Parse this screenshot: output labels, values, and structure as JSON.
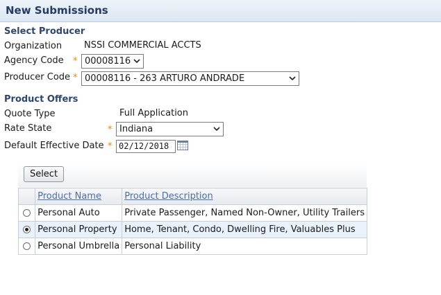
{
  "header": {
    "title": "New Submissions"
  },
  "select_producer": {
    "heading": "Select Producer",
    "organization_label": "Organization",
    "organization_value": "NSSI COMMERCIAL ACCTS",
    "agency_code_label": "Agency Code",
    "agency_code_value": "00008116",
    "producer_code_label": "Producer Code",
    "producer_code_value": "00008116 - 263 ARTURO ANDRADE"
  },
  "product_offers": {
    "heading": "Product Offers",
    "quote_type_label": "Quote Type",
    "quote_type_value": "Full Application",
    "rate_state_label": "Rate State",
    "rate_state_value": "Indiana",
    "effective_date_label": "Default Effective Date",
    "effective_date_value": "02/12/2018",
    "required_marker": "*"
  },
  "select_button": {
    "label": "Select"
  },
  "products_table": {
    "columns": [
      "Product Name",
      "Product Description"
    ],
    "rows": [
      {
        "name": "Personal Auto",
        "description": "Private Passenger, Named Non-Owner, Utility Trailers",
        "selected": false
      },
      {
        "name": "Personal Property",
        "description": "Home, Tenant, Condo, Dwelling Fire, Valuables Plus",
        "selected": true
      },
      {
        "name": "Personal Umbrella",
        "description": "Personal Liability",
        "selected": false
      }
    ]
  },
  "colors": {
    "required": "#e08a2a",
    "heading": "#2d476f",
    "link": "#4a6fa8",
    "selected_row": "#e9f1fb"
  }
}
